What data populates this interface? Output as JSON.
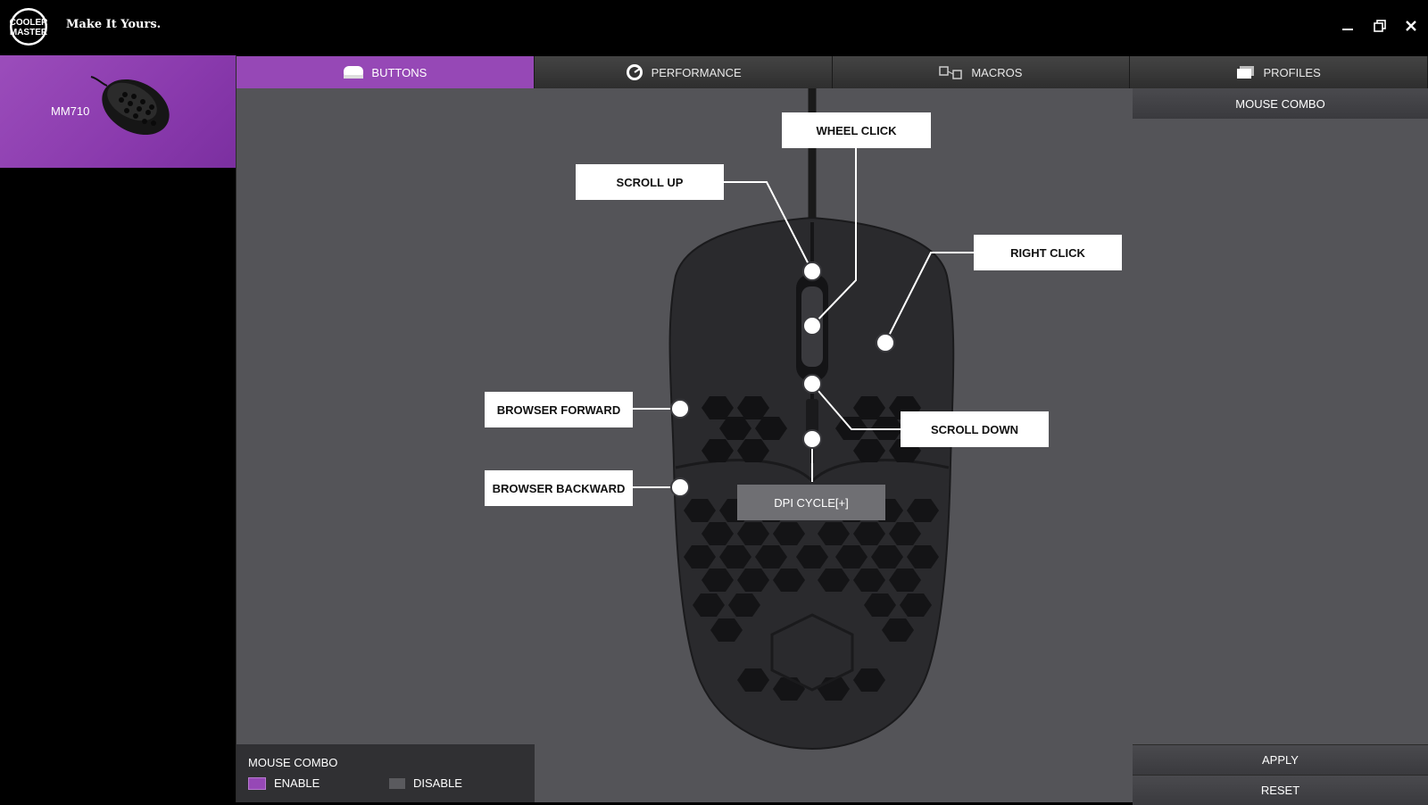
{
  "app": {
    "brand": "COOLER MASTER",
    "tagline": "Make It Yours.",
    "window_controls": [
      "minimize-icon",
      "restore-icon",
      "close-icon"
    ]
  },
  "sidebar": {
    "device": {
      "name": "MM710",
      "selected": true
    }
  },
  "tabs": [
    {
      "label": "BUTTONS",
      "icon": "mouse-icon",
      "active": true
    },
    {
      "label": "PERFORMANCE",
      "icon": "gauge-icon",
      "active": false
    },
    {
      "label": "MACROS",
      "icon": "macro-icon",
      "active": false
    },
    {
      "label": "PROFILES",
      "icon": "profiles-icon",
      "active": false
    }
  ],
  "buttons": {
    "wheel_click": "WHEEL CLICK",
    "scroll_up": "SCROLL UP",
    "right_click": "RIGHT CLICK",
    "browser_forward": "BROWSER FORWARD",
    "scroll_down": "SCROLL DOWN",
    "browser_backward": "BROWSER BACKWARD",
    "dpi_cycle": "DPI CYCLE[+]"
  },
  "right_panel": {
    "mouse_combo_tab": "MOUSE COMBO",
    "apply": "APPLY",
    "reset": "RESET"
  },
  "mouse_combo": {
    "title": "MOUSE COMBO",
    "options": [
      {
        "label": "ENABLE",
        "color": "#9648b6",
        "selected": true
      },
      {
        "label": "DISABLE",
        "color": "#5a5a5e",
        "selected": false
      }
    ]
  },
  "colors": {
    "accent": "#9648b6",
    "background": "#545458",
    "sidebar": "#000000"
  }
}
